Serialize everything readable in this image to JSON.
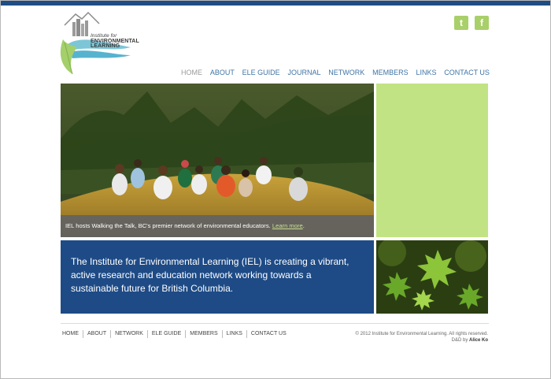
{
  "brand": {
    "logo_line1": "Institute for",
    "logo_line2": "ENVIRONMENTAL",
    "logo_line3": "LEARNING"
  },
  "social": {
    "twitter_glyph": "t",
    "facebook_glyph": "f"
  },
  "colors": {
    "top_bar": "#1f4d83",
    "accent_green": "#c2e383",
    "panel_blue": "#1e4b86",
    "link_blue": "#3f74a6"
  },
  "nav": {
    "items": [
      "HOME",
      "ABOUT",
      "ELE GUIDE",
      "JOURNAL",
      "NETWORK",
      "MEMBERS",
      "LINKS",
      "CONTACT US"
    ],
    "active": "HOME"
  },
  "hero": {
    "caption": "IEL hosts Walking the Talk, BC's premier network of environmental educators.",
    "caption_link": "Learn more",
    "caption_end": "."
  },
  "intro": {
    "text": "The Institute for Environmental Learning (IEL) is creating a vibrant, active research and education network working towards a sustainable future for British Columbia."
  },
  "footer": {
    "links": [
      "HOME",
      "ABOUT",
      "NETWORK",
      "ELE GUIDE",
      "MEMBERS",
      "LINKS",
      "CONTACT US"
    ],
    "copyright": "© 2012 Institute for Environmental Learning. All rights reserved.",
    "credit_prefix": "D&D by",
    "credit_name": "Alice Ko"
  }
}
